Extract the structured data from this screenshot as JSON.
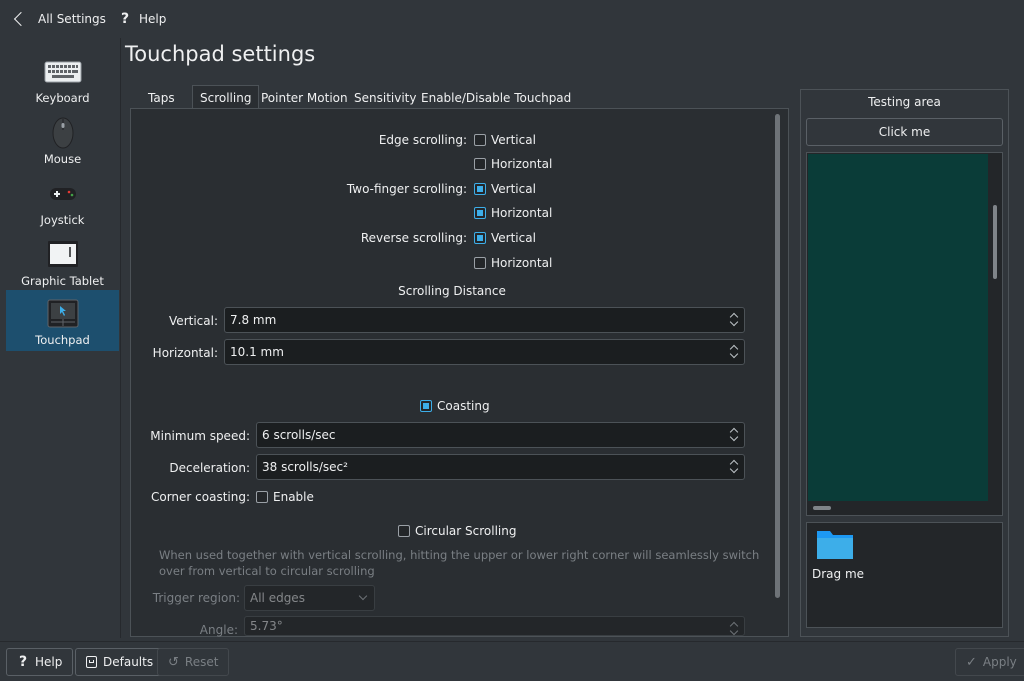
{
  "topbar": {
    "back_label": "All Settings",
    "help_label": "Help"
  },
  "sidebar": {
    "items": [
      {
        "label": "Keyboard",
        "icon": "keyboard-icon"
      },
      {
        "label": "Mouse",
        "icon": "mouse-icon"
      },
      {
        "label": "Joystick",
        "icon": "gamepad-icon"
      },
      {
        "label": "Graphic Tablet",
        "icon": "tablet-icon"
      },
      {
        "label": "Touchpad",
        "icon": "touchpad-icon",
        "active": true
      }
    ]
  },
  "page": {
    "title": "Touchpad settings"
  },
  "tabs": [
    {
      "label": "Taps"
    },
    {
      "label": "Scrolling",
      "active": true
    },
    {
      "label": "Pointer Motion"
    },
    {
      "label": "Sensitivity"
    },
    {
      "label": "Enable/Disable Touchpad"
    }
  ],
  "scrolling": {
    "edge_label": "Edge scrolling:",
    "two_finger_label": "Two-finger scrolling:",
    "reverse_label": "Reverse scrolling:",
    "vertical_label": "Vertical",
    "horizontal_label": "Horizontal",
    "edge_vertical": false,
    "edge_horizontal": false,
    "two_finger_vertical": true,
    "two_finger_horizontal": true,
    "reverse_vertical": true,
    "reverse_horizontal": false,
    "distance_heading": "Scrolling Distance",
    "distance_vertical_label": "Vertical:",
    "distance_vertical_value": "7.8 mm",
    "distance_horizontal_label": "Horizontal:",
    "distance_horizontal_value": "10.1 mm"
  },
  "coasting": {
    "label": "Coasting",
    "enabled": true,
    "min_speed_label": "Minimum speed:",
    "min_speed_value": "6 scrolls/sec",
    "decel_label": "Deceleration:",
    "decel_value": "38 scrolls/sec²",
    "corner_label": "Corner coasting:",
    "corner_enable_label": "Enable",
    "corner_enabled": false
  },
  "circular": {
    "label": "Circular Scrolling",
    "enabled": false,
    "description_line1": "When used together with vertical scrolling, hitting the upper or lower right corner will seamlessly switch",
    "description_line2": "over from vertical to circular scrolling",
    "trigger_label": "Trigger region:",
    "trigger_value": "All edges",
    "angle_label": "Angle:",
    "angle_value": "5.73°"
  },
  "testing": {
    "title": "Testing area",
    "click_label": "Click me",
    "drag_label": "Drag me"
  },
  "footer": {
    "help_label": "Help",
    "defaults_label": "Defaults",
    "reset_label": "Reset",
    "apply_label": "Apply"
  },
  "colors": {
    "accent": "#3daee9",
    "background": "#31363b",
    "panel": "#2a2e32",
    "selected": "#1d4f6e"
  }
}
